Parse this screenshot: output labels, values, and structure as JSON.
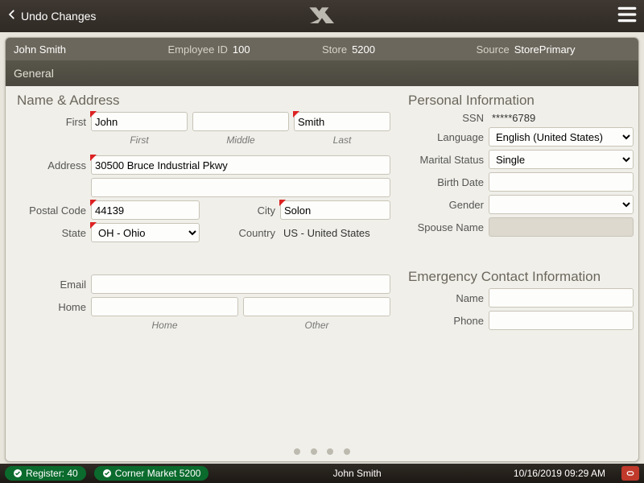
{
  "topbar": {
    "undo_label": "Undo Changes"
  },
  "info_strip": {
    "name": "John Smith",
    "emp_id_label": "Employee ID",
    "emp_id": "100",
    "store_label": "Store",
    "store": "5200",
    "source_label": "Source",
    "source": "StorePrimary"
  },
  "tab": {
    "general": "General"
  },
  "name_addr": {
    "title": "Name & Address",
    "first_label": "First",
    "first_sub": "First",
    "middle_sub": "Middle",
    "last_sub": "Last",
    "first": "John",
    "middle": "",
    "last": "Smith",
    "address_label": "Address",
    "address1": "30500 Bruce Industrial Pkwy",
    "address2": "",
    "postal_label": "Postal Code",
    "postal": "44139",
    "city_label": "City",
    "city": "Solon",
    "state_label": "State",
    "state": "OH - Ohio",
    "country_label": "Country",
    "country": "US - United States",
    "email_label": "Email",
    "email": "",
    "home_label": "Home",
    "home": "",
    "other": "",
    "home_sub": "Home",
    "other_sub": "Other"
  },
  "personal": {
    "title": "Personal Information",
    "ssn_label": "SSN",
    "ssn": "*****6789",
    "lang_label": "Language",
    "lang": "English (United States)",
    "marital_label": "Marital Status",
    "marital": "Single",
    "birth_label": "Birth Date",
    "birth": "",
    "gender_label": "Gender",
    "gender": "",
    "spouse_label": "Spouse Name"
  },
  "emergency": {
    "title": "Emergency Contact Information",
    "name_label": "Name",
    "name": "",
    "phone_label": "Phone",
    "phone": ""
  },
  "status": {
    "register": "Register: 40",
    "market": "Corner Market 5200",
    "user": "John Smith",
    "datetime": "10/16/2019 09:29 AM"
  }
}
